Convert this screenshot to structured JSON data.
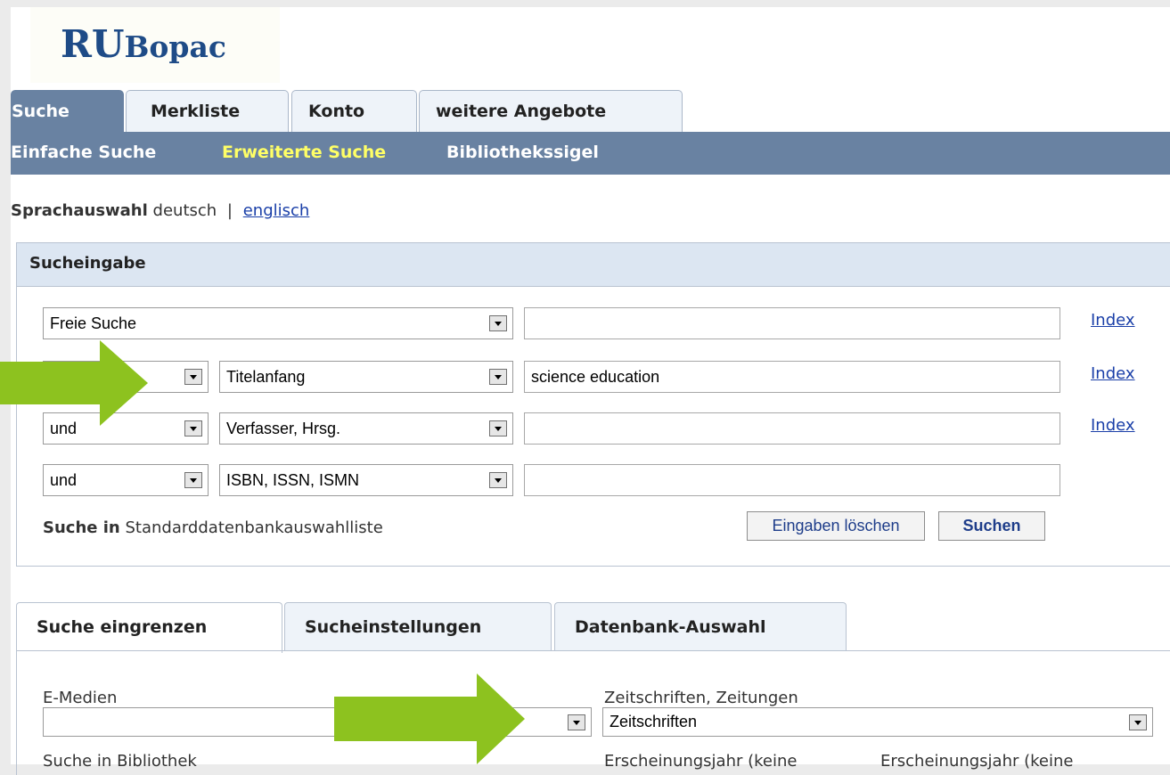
{
  "logo": {
    "main": "RU",
    "rest": "Bopac"
  },
  "tabs": [
    {
      "label": "Suche",
      "active": true
    },
    {
      "label": "Merkliste",
      "active": false
    },
    {
      "label": "Konto",
      "active": false
    },
    {
      "label": "weitere Angebote",
      "active": false
    }
  ],
  "subnav": [
    {
      "label": "Einfache Suche",
      "active": false
    },
    {
      "label": "Erweiterte Suche",
      "active": true
    },
    {
      "label": "Bibliothekssigel",
      "active": false
    }
  ],
  "language": {
    "label": "Sprachauswahl",
    "current": "deutsch",
    "separator": "|",
    "other": "englisch"
  },
  "search": {
    "heading": "Sucheingabe",
    "rows": [
      {
        "operator": "",
        "field": "Freie Suche",
        "value": "",
        "index": "Index"
      },
      {
        "operator": "",
        "field": "Titelanfang",
        "value": "science education",
        "index": "Index"
      },
      {
        "operator": "und",
        "field": "Verfasser, Hrsg.",
        "value": "",
        "index": "Index"
      },
      {
        "operator": "und",
        "field": "ISBN, ISSN, ISMN",
        "value": "",
        "index": ""
      }
    ],
    "search_in_label": "Suche in",
    "search_in_value": "Standarddatenbankauswahlliste",
    "clear_button": "Eingaben löschen",
    "submit_button": "Suchen"
  },
  "lower_tabs": [
    {
      "label": "Suche eingrenzen",
      "active": true
    },
    {
      "label": "Sucheinstellungen",
      "active": false
    },
    {
      "label": "Datenbank-Auswahl",
      "active": false
    }
  ],
  "filters": {
    "emedien_label": "E-Medien",
    "emedien_value": "",
    "zeitschriften_label": "Zeitschriften, Zeitungen",
    "zeitschriften_value": "Zeitschriften",
    "bibliothek_label": "Suche in Bibliothek",
    "erscheinung1": "Erscheinungsjahr (keine",
    "erscheinung2": "Erscheinungsjahr (keine"
  },
  "colors": {
    "nav": "#6982a2",
    "active_subnav": "#ffff66",
    "arrow": "#8dc21f",
    "link": "#1a3fa8"
  }
}
